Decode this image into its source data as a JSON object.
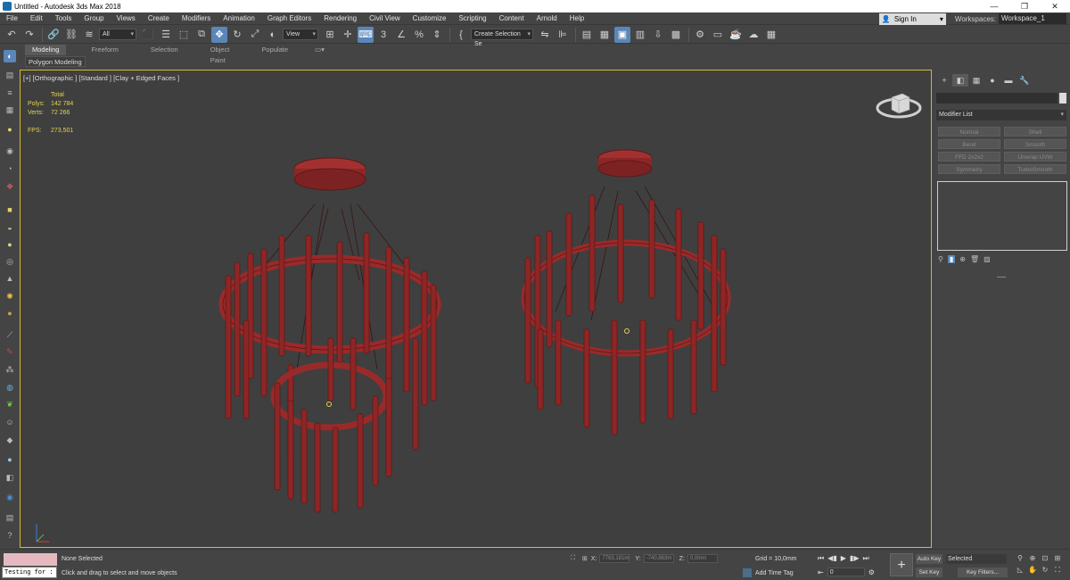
{
  "window": {
    "title": "Untitled - Autodesk 3ds Max 2018"
  },
  "menu": [
    "File",
    "Edit",
    "Tools",
    "Group",
    "Views",
    "Create",
    "Modifiers",
    "Animation",
    "Graph Editors",
    "Rendering",
    "Civil View",
    "Customize",
    "Scripting",
    "Content",
    "Arnold",
    "Help"
  ],
  "account": {
    "signin": "Sign In",
    "workspaces_label": "Workspaces:",
    "workspace": "Workspace_1"
  },
  "toolbar": {
    "filter": "All",
    "refcoord": "View",
    "selset": "Create Selection Se"
  },
  "ribbon": {
    "tabs": [
      "Modeling",
      "Freeform",
      "Selection",
      "Object Paint",
      "Populate"
    ],
    "sub": "Polygon Modeling"
  },
  "viewport": {
    "label": "[+] [Orthographic ] [Standard ] [Clay + Edged Faces ]",
    "total_label": "Total",
    "polys_label": "Polys:",
    "polys": "142 784",
    "verts_label": "Verts:",
    "verts": "72 266",
    "fps_label": "FPS:",
    "fps": "273,501"
  },
  "command_panel": {
    "modifier_list": "Modifier List",
    "modifiers": [
      "Normal",
      "Shell",
      "Bend",
      "Smooth",
      "FFD 2x2x2",
      "Unwrap UVW",
      "Symmetry",
      "TurboSmooth"
    ]
  },
  "status": {
    "listener": "Testing for :",
    "selection": "None Selected",
    "prompt": "Click and drag to select and move objects",
    "x_label": "X:",
    "x": "7763,181m",
    "y_label": "Y:",
    "y": "-740,863m",
    "z_label": "Z:",
    "z": "0,0mm",
    "grid": "Grid = 10,0mm",
    "add_time_tag": "Add Time Tag",
    "frame": "0",
    "auto_key": "Auto Key",
    "set_key": "Set Key",
    "selected": "Selected",
    "key_filters": "Key Filters..."
  },
  "colors": {
    "mesh": "#9a2a2a",
    "viewport_border": "#d7b92d",
    "active_tool": "#5a86b8"
  }
}
